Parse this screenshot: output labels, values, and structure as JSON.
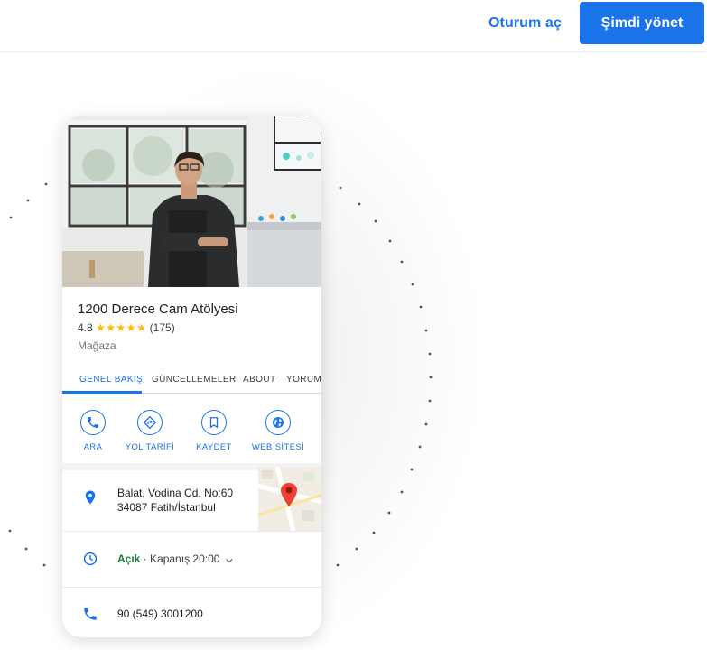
{
  "header": {
    "signin_label": "Oturum aç",
    "manage_label": "Şimdi yönet"
  },
  "business": {
    "name": "1200 Derece Cam Atölyesi",
    "rating": "4.8",
    "stars": "★★★★★",
    "review_count": "(175)",
    "category": "Mağaza"
  },
  "tabs": [
    {
      "label": "GENEL BAKIŞ",
      "active": true
    },
    {
      "label": "GÜNCELLEMELER",
      "active": false
    },
    {
      "label": "ABOUT",
      "active": false
    },
    {
      "label": "YORUMLAR",
      "active": false
    }
  ],
  "actions": [
    {
      "label": "ARA",
      "icon": "phone-icon"
    },
    {
      "label": "YOL TARİFİ",
      "icon": "directions-icon"
    },
    {
      "label": "KAYDET",
      "icon": "bookmark-icon"
    },
    {
      "label": "WEB SİTESİ",
      "icon": "globe-icon"
    }
  ],
  "address": {
    "line1": "Balat, Vodina Cd. No:60",
    "line2": "34087 Fatih/İstanbul"
  },
  "hours": {
    "status": "Açık",
    "separator": " · ",
    "closing": "Kapanış 20:00"
  },
  "phone": "90 (549) 3001200",
  "colors": {
    "accent": "#1a73e8",
    "open": "#188038",
    "star": "#fbbc04",
    "pin": "#ea4335"
  }
}
